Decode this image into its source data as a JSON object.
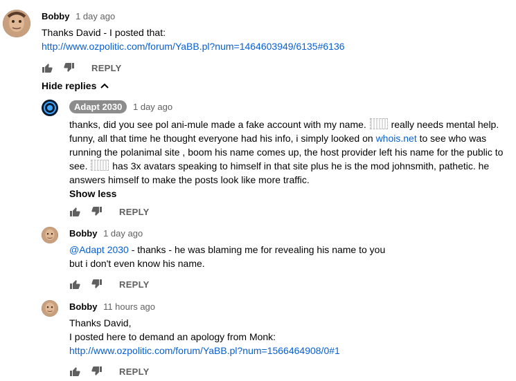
{
  "comments": [
    {
      "author": "Bobby",
      "time": "1 day ago",
      "line1": "Thanks David - I posted that:",
      "link": "http://www.ozpolitic.com/forum/YaBB.pl?num=1464603949/6135#6136",
      "reply_label": "REPLY"
    }
  ],
  "hide_replies_label": "Hide replies",
  "replies": [
    {
      "author": "Adapt 2030",
      "time": "1 day ago",
      "text_a": "thanks, did you see pol ani-mule made a fake account with my name.",
      "text_b": "really needs mental help. funny, all that time he thought everyone had his info, i simply looked on",
      "link": "whois.net",
      "text_c": "to see who was running the polanimal site , boom his name comes up, the host provider left his name for the public to see.",
      "text_d": "has 3x avatars speaking to himself in that site plus he is the mod johnsmith, pathetic. he answers himself to make the posts look like more traffic.",
      "show_less": "Show less",
      "reply_label": "REPLY"
    },
    {
      "author": "Bobby",
      "time": "1 day ago",
      "mention": "@Adapt 2030",
      "line1_rest": " - thanks - he was blaming me for revealing his name to you",
      "line2": "but i don't even know his name.",
      "reply_label": "REPLY"
    },
    {
      "author": "Bobby",
      "time": "11 hours ago",
      "line1": "Thanks David,",
      "line2": "I posted here to demand an apology from Monk:",
      "link": "http://www.ozpolitic.com/forum/YaBB.pl?num=1566464908/0#1",
      "reply_label": "REPLY"
    }
  ],
  "icons": [
    "thumb-up-icon",
    "thumb-down-icon",
    "chevron-up-icon"
  ],
  "colors": {
    "link": "#065fd4",
    "meta": "#606060",
    "badge": "#8c8c8c"
  }
}
